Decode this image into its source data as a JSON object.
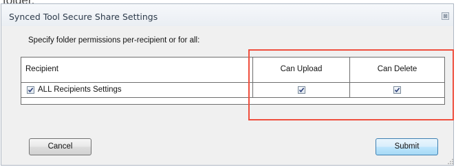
{
  "caption": "folder.",
  "dialog": {
    "title": "Synced Tool Secure Share Settings",
    "close_glyph": "⊠",
    "instruction": "Specify folder permissions per-recipient or for all:",
    "table": {
      "headers": [
        "Recipient",
        "Can Upload",
        "Can Delete"
      ],
      "rows": [
        {
          "recipient": "ALL Recipients Settings",
          "recipient_checked": true,
          "can_upload": true,
          "can_delete": true
        }
      ]
    },
    "buttons": {
      "cancel": "Cancel",
      "submit": "Submit"
    }
  },
  "colors": {
    "highlight": "#ef4d3c",
    "check_mark": "#2a3f7a",
    "default_button_border": "#3c7fb1"
  }
}
